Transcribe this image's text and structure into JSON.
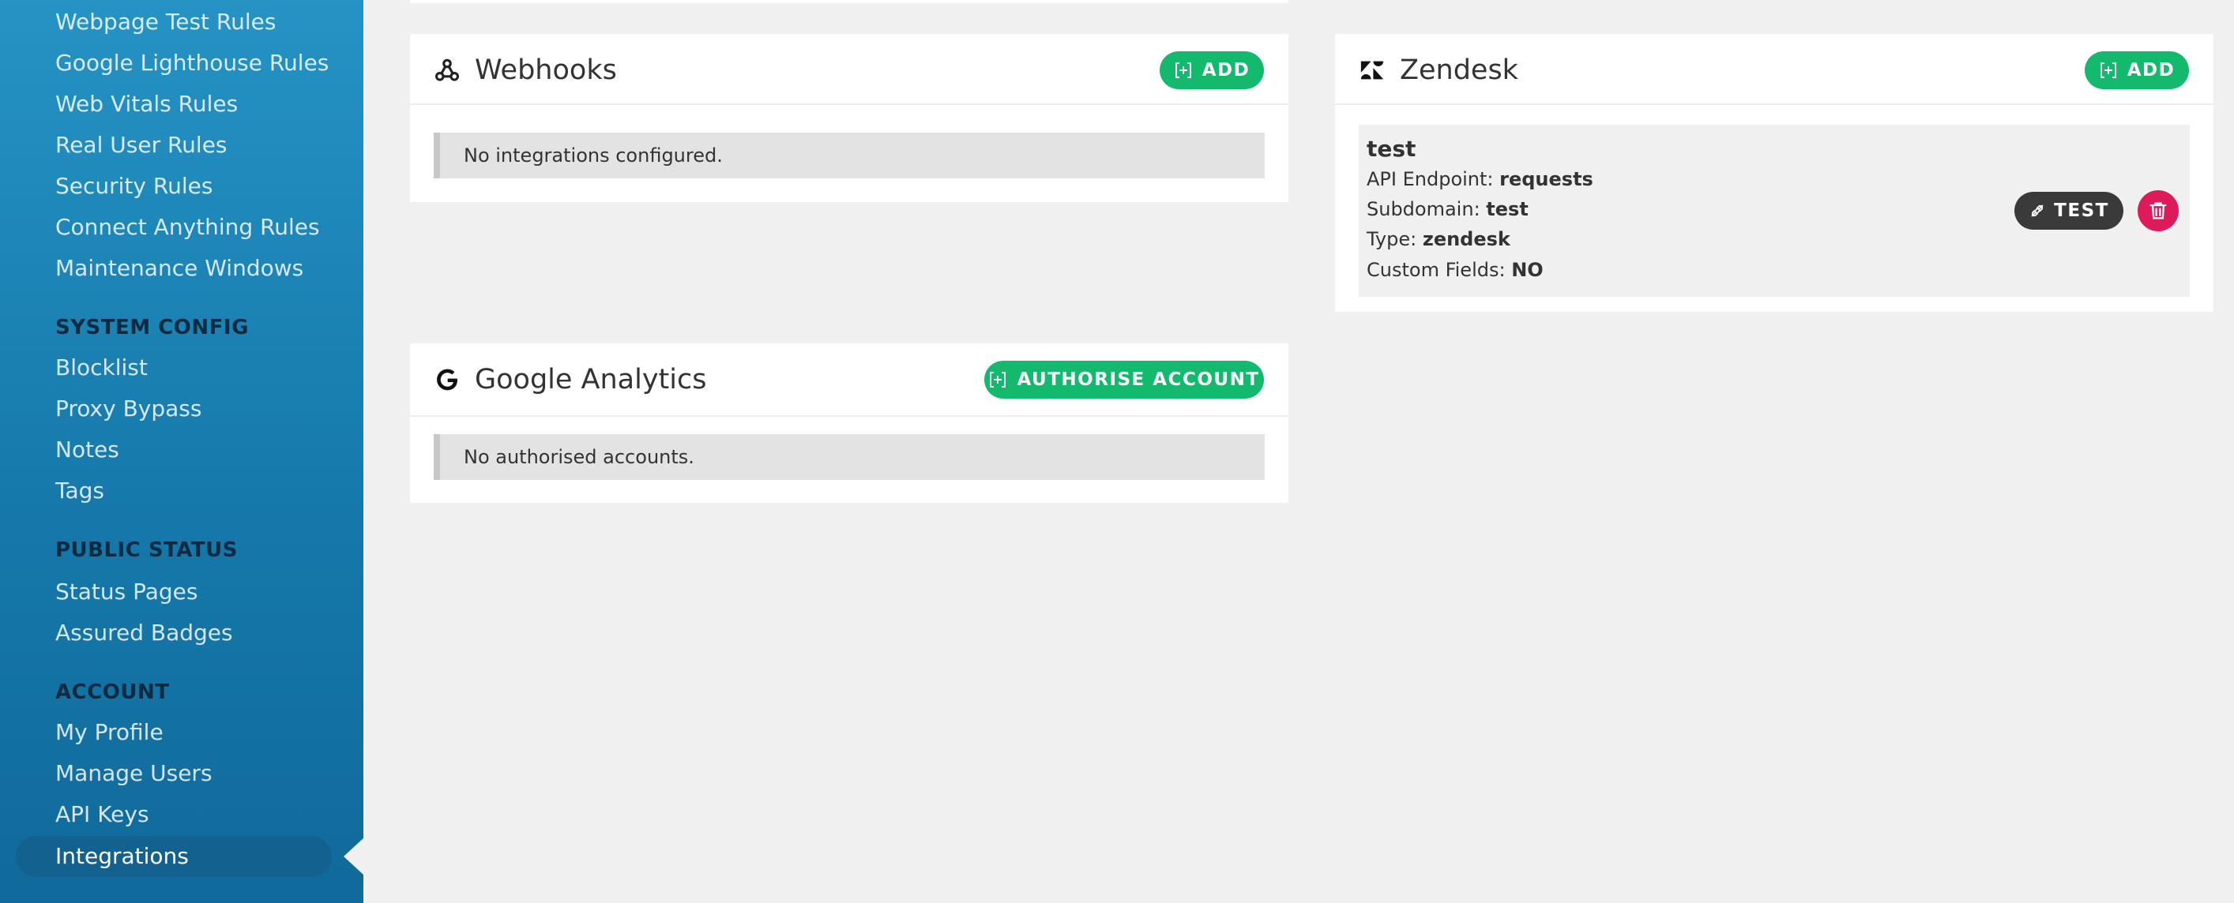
{
  "sidebar": {
    "rules_items": [
      {
        "label": "Webpage Test Rules"
      },
      {
        "label": "Google Lighthouse Rules"
      },
      {
        "label": "Web Vitals Rules"
      },
      {
        "label": "Real User Rules"
      },
      {
        "label": "Security Rules"
      },
      {
        "label": "Connect Anything Rules"
      },
      {
        "label": "Maintenance Windows"
      }
    ],
    "system_config": {
      "heading": "SYSTEM CONFIG",
      "items": [
        {
          "label": "Blocklist"
        },
        {
          "label": "Proxy Bypass"
        },
        {
          "label": "Notes"
        },
        {
          "label": "Tags"
        }
      ]
    },
    "public_status": {
      "heading": "PUBLIC STATUS",
      "items": [
        {
          "label": "Status Pages"
        },
        {
          "label": "Assured Badges"
        }
      ]
    },
    "account": {
      "heading": "ACCOUNT",
      "items": [
        {
          "label": "My Profile"
        },
        {
          "label": "Manage Users"
        },
        {
          "label": "API Keys"
        },
        {
          "label": "Integrations"
        }
      ]
    }
  },
  "webhooks": {
    "title": "Webhooks",
    "add_label": "ADD",
    "empty_text": "No integrations configured."
  },
  "google_analytics": {
    "title": "Google Analytics",
    "authorise_label": "AUTHORISE ACCOUNT",
    "empty_text": "No authorised accounts."
  },
  "zendesk": {
    "title": "Zendesk",
    "add_label": "ADD",
    "entry": {
      "name": "test",
      "fields": [
        {
          "label": "API Endpoint:",
          "value": "requests"
        },
        {
          "label": "Subdomain:",
          "value": "test"
        },
        {
          "label": "Type:",
          "value": "zendesk"
        },
        {
          "label": "Custom Fields:",
          "value": "NO"
        }
      ],
      "test_label": "TEST"
    }
  },
  "colors": {
    "sidebar_top": "#2593c4",
    "sidebar_bottom": "#106a9b",
    "accent_green": "#13b96c",
    "delete_red": "#dd1b5b",
    "dark_button": "#3a3a3a"
  }
}
